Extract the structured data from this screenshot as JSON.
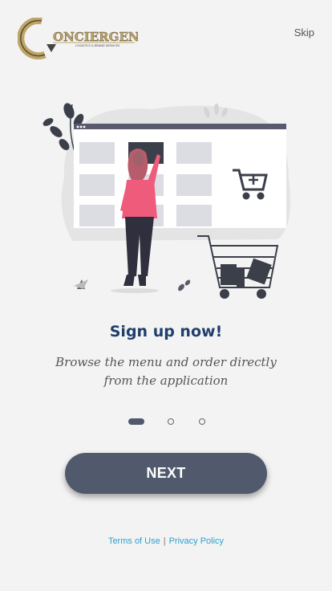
{
  "brand": {
    "name": "ONCIERGENCE",
    "tagline": "LOGISTICS & BRAND SERVICES"
  },
  "header": {
    "skip_label": "Skip"
  },
  "onboarding": {
    "title": "Sign up now!",
    "description": "Browse the menu and order directly from the application",
    "page_count": 3,
    "active_page": 1
  },
  "actions": {
    "next_label": "NEXT"
  },
  "footer": {
    "terms_label": "Terms of Use",
    "separator": "|",
    "privacy_label": "Privacy Policy"
  },
  "colors": {
    "accent": "#515a6c",
    "heading": "#1f3f6b",
    "link": "#2f9fcf",
    "illustration_pink": "#ef5b7a",
    "logo_gold": "#c8b27a"
  }
}
